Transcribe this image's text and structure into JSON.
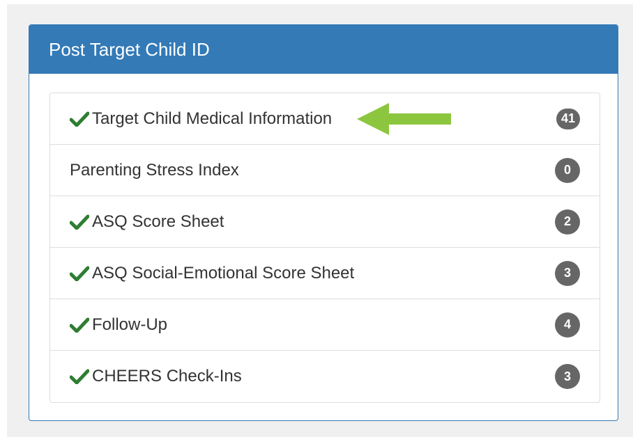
{
  "panel": {
    "title": "Post Target Child ID"
  },
  "items": [
    {
      "label": "Target Child Medical Information",
      "count": "41",
      "checked": true
    },
    {
      "label": "Parenting Stress Index",
      "count": "0",
      "checked": false
    },
    {
      "label": "ASQ Score Sheet",
      "count": "2",
      "checked": true
    },
    {
      "label": "ASQ Social-Emotional Score Sheet",
      "count": "3",
      "checked": true
    },
    {
      "label": "Follow-Up",
      "count": "4",
      "checked": true
    },
    {
      "label": "CHEERS Check-Ins",
      "count": "3",
      "checked": true
    }
  ],
  "colors": {
    "panel_primary": "#337ab7",
    "check_green": "#2e7d32",
    "badge_gray": "#666666",
    "arrow_green": "#8cc63f"
  },
  "annotation": {
    "arrow_icon": "left-arrow-icon",
    "points_to_item": 0
  }
}
